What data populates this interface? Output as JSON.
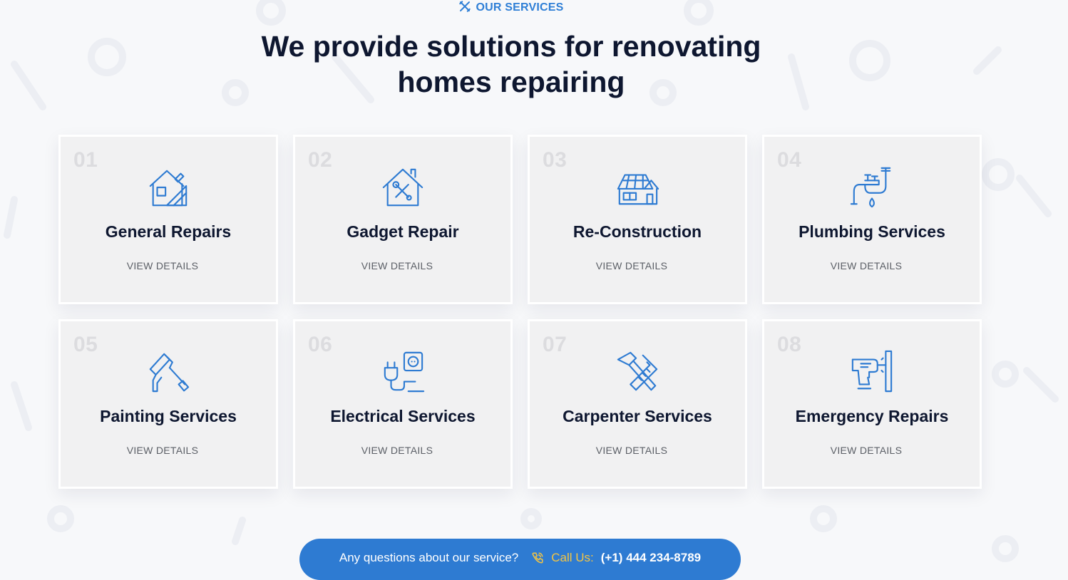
{
  "section": {
    "eyebrow": "OUR SERVICES",
    "eyebrow_icon": "tools-icon",
    "headline_line1": "We provide solutions for renovating",
    "headline_line2": "homes repairing"
  },
  "services": [
    {
      "num": "01",
      "title": "General Repairs",
      "link": "VIEW DETAILS",
      "icon": "house-tools-icon"
    },
    {
      "num": "02",
      "title": "Gadget Repair",
      "link": "VIEW DETAILS",
      "icon": "house-wrench-icon"
    },
    {
      "num": "03",
      "title": "Re-Construction",
      "link": "VIEW DETAILS",
      "icon": "house-solar-icon"
    },
    {
      "num": "04",
      "title": "Plumbing Services",
      "link": "VIEW DETAILS",
      "icon": "pipe-faucet-icon"
    },
    {
      "num": "05",
      "title": "Painting Services",
      "link": "VIEW DETAILS",
      "icon": "paint-roller-icon"
    },
    {
      "num": "06",
      "title": "Electrical Services",
      "link": "VIEW DETAILS",
      "icon": "plug-socket-icon"
    },
    {
      "num": "07",
      "title": "Carpenter Services",
      "link": "VIEW DETAILS",
      "icon": "hammer-saw-icon"
    },
    {
      "num": "08",
      "title": "Emergency Repairs",
      "link": "VIEW DETAILS",
      "icon": "drill-wall-icon"
    }
  ],
  "cta": {
    "question": "Any questions about our service?",
    "call_label": "Call Us:",
    "phone": "(+1) 444 234-8789",
    "phone_icon": "phone-icon"
  },
  "colors": {
    "accent": "#2e7bd2",
    "heading": "#0e1730",
    "card_bg": "#f1f1f2",
    "number": "#dcdcdf",
    "call_label": "#f5c542"
  }
}
